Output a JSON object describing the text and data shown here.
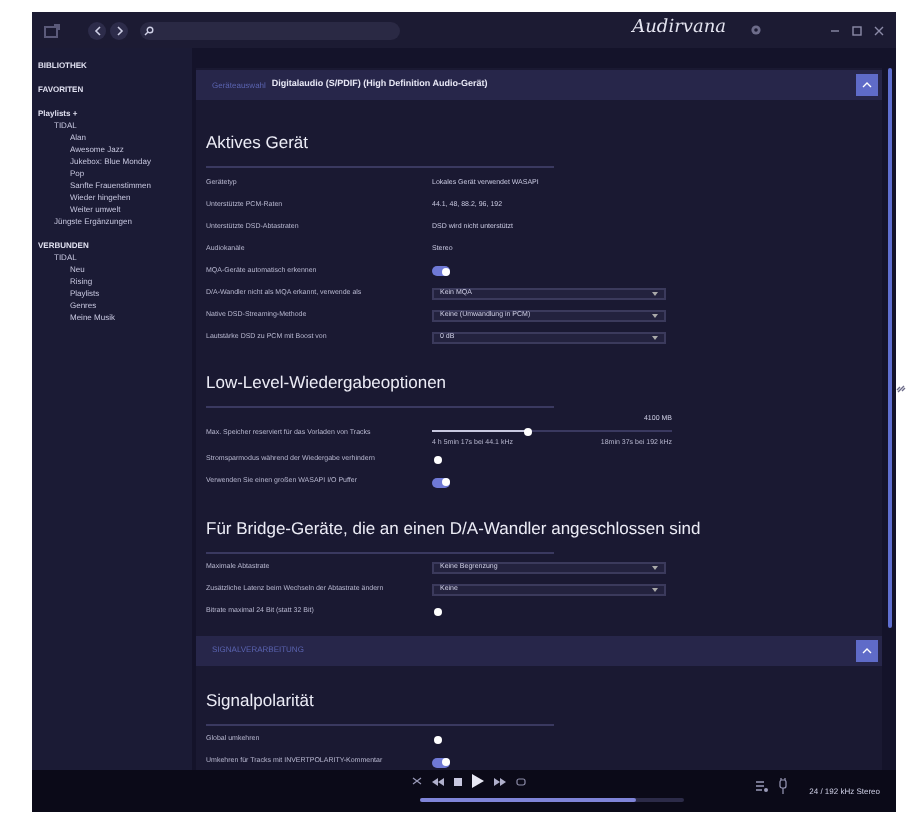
{
  "titlebar": {
    "logo": "Audirvana"
  },
  "sidebar": {
    "sections": [
      {
        "label": "BIBLIOTHEK"
      },
      {
        "label": "FAVORITEN"
      },
      {
        "label": "Playlists +",
        "items": [
          {
            "label": "TIDAL",
            "children": [
              {
                "label": "Alan"
              },
              {
                "label": "Awesome Jazz"
              },
              {
                "label": "Jukebox: Blue Monday"
              },
              {
                "label": "Pop"
              },
              {
                "label": "Sanfte Frauenstimmen"
              },
              {
                "label": "Wieder hingehen"
              },
              {
                "label": "Weiter umwelt"
              }
            ]
          },
          {
            "label": "Jüngste Ergänzungen"
          }
        ]
      },
      {
        "label": "VERBUNDEN",
        "items": [
          {
            "label": "TIDAL",
            "children": [
              {
                "label": "Neu"
              },
              {
                "label": "Rising"
              },
              {
                "label": "Playlists"
              },
              {
                "label": "Genres"
              },
              {
                "label": "Meine Musik"
              }
            ]
          }
        ]
      }
    ]
  },
  "blocks": [
    {
      "kind": "bar",
      "crumb": "Geräteauswahl",
      "title": "Digitalaudio (S/PDIF) (High Definition Audio-Gerät)"
    },
    {
      "kind": "heading",
      "text": "Aktives Gerät"
    },
    {
      "kind": "text",
      "label": "Gerätetyp",
      "value": "Lokales Gerät verwendet WASAPI"
    },
    {
      "kind": "text",
      "label": "Unterstützte PCM-Raten",
      "value": "44.1, 48, 88.2, 96, 192"
    },
    {
      "kind": "text",
      "label": "Unterstützte DSD-Abtastraten",
      "value": "DSD wird nicht unterstützt"
    },
    {
      "kind": "text",
      "label": "Audiokanäle",
      "value": "Stereo"
    },
    {
      "kind": "toggle",
      "label": "MQA-Geräte automatisch erkennen",
      "on": true
    },
    {
      "kind": "spacer"
    },
    {
      "kind": "select",
      "label": "D/A-Wandler nicht als MQA erkannt, verwende als",
      "value": "Kein MQA"
    },
    {
      "kind": "select",
      "label": "Native DSD-Streaming-Methode",
      "value": "Keine (Umwandlung in PCM)"
    },
    {
      "kind": "select",
      "label": "Lautstärke DSD zu PCM mit Boost von",
      "value": "0 dB"
    },
    {
      "kind": "heading",
      "text": "Low-Level-Wiedergabeoptionen"
    },
    {
      "kind": "slider",
      "label": "Max. Speicher reserviert für das Vorladen von Tracks",
      "reading": "4100 MB",
      "level": 0.4,
      "min_caption": "4 h 5min 17s bei 44.1 kHz",
      "max_caption": "18min 37s bei 192 kHz"
    },
    {
      "kind": "toggle",
      "label": "Stromsparmodus während der Wiedergabe verhindern",
      "on": false
    },
    {
      "kind": "toggle",
      "label": "Verwenden Sie einen großen WASAPI I/O Puffer",
      "on": true
    },
    {
      "kind": "heading",
      "text": "Für Bridge-Geräte, die an einen D/A-Wandler angeschlossen sind"
    },
    {
      "kind": "select",
      "label": "Maximale Abtastrate",
      "value": "Keine Begrenzung"
    },
    {
      "kind": "select",
      "label": "Zusätzliche Latenz beim Wechseln der Abtastrate ändern",
      "value": "Keine"
    },
    {
      "kind": "toggle",
      "label": "Bitrate maximal 24 Bit (statt 32 Bit)",
      "on": false
    },
    {
      "kind": "bar",
      "crumb": "SIGNALVERARBEITUNG"
    },
    {
      "kind": "heading",
      "text": "Signalpolarität"
    },
    {
      "kind": "toggle",
      "label": "Global umkehren",
      "on": false
    },
    {
      "kind": "toggle",
      "label": "Umkehren für Tracks mit INVERTPOLARITY-Kommentar",
      "on": true
    }
  ],
  "player": {
    "level": 0.82,
    "format": "24 / 192 kHz Stereo"
  }
}
